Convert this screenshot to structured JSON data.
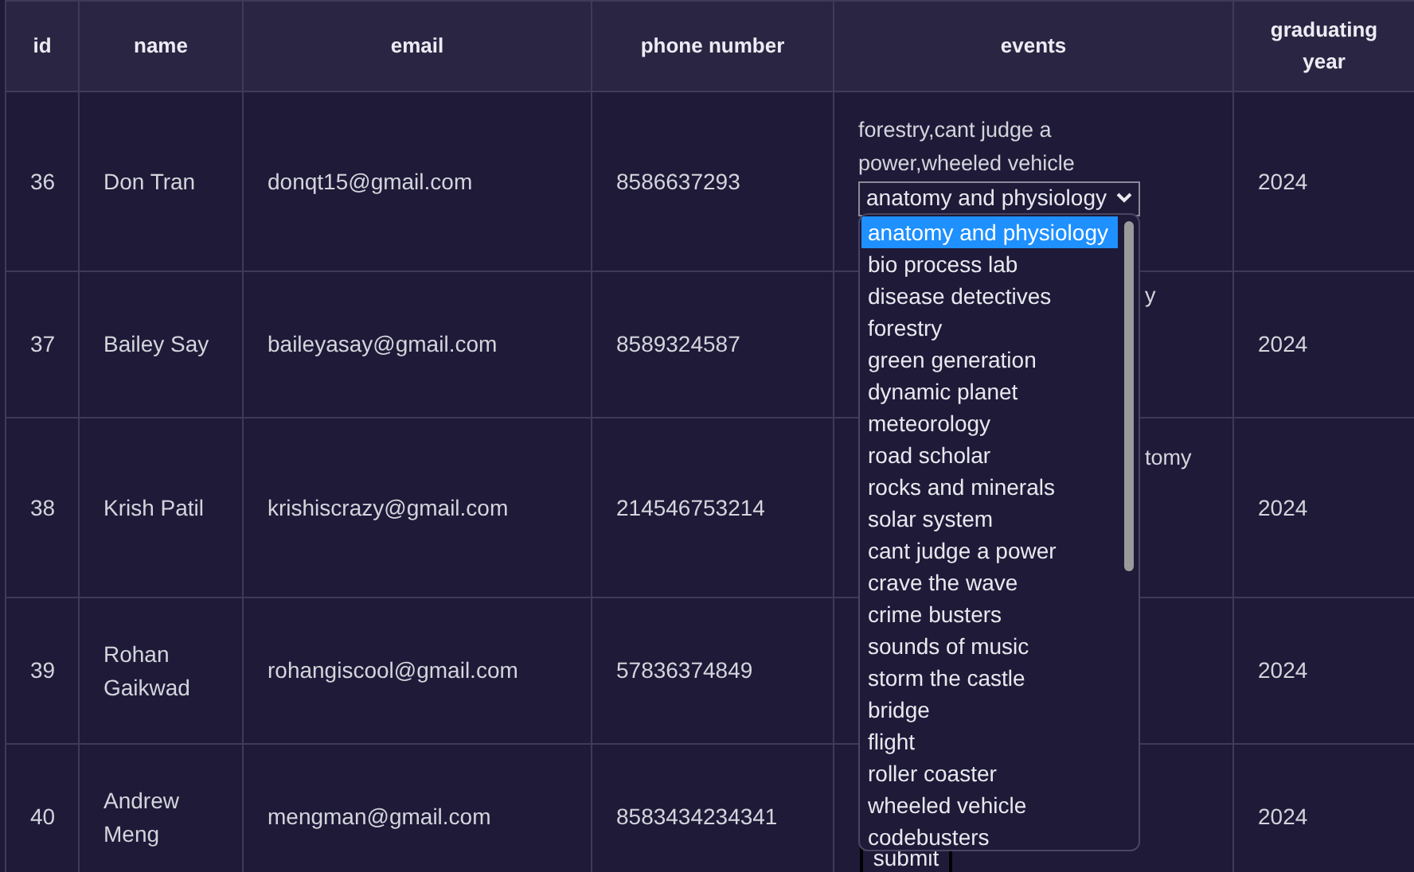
{
  "table": {
    "columns": [
      "id",
      "name",
      "email",
      "phone number",
      "events",
      "graduating year"
    ],
    "rows": [
      {
        "id": "36",
        "name": "Don Tran",
        "email": "donqt15@gmail.com",
        "phone": "8586637293",
        "events": {
          "text": "forestry,cant judge a power,wheeled vehicle",
          "select": "anatomy and physiology"
        },
        "year": "2024"
      },
      {
        "id": "37",
        "name": "Bailey Say",
        "email": "baileyasay@gmail.com",
        "phone": "8589324587",
        "events": {
          "fragment": "y"
        },
        "year": "2024"
      },
      {
        "id": "38",
        "name": "Krish Patil",
        "email": "krishiscrazy@gmail.com",
        "phone": "214546753214",
        "events": {
          "fragment": "tomy"
        },
        "year": "2024"
      },
      {
        "id": "39",
        "name": "Rohan Gaikwad",
        "email": "rohangiscool@gmail.com",
        "phone": "57836374849",
        "events": {},
        "year": "2024"
      },
      {
        "id": "40",
        "name": "Andrew Meng",
        "email": "mengman@gmail.com",
        "phone": "8583434234341",
        "events": {
          "button": "submit"
        },
        "year": "2024"
      }
    ]
  },
  "dropdown": {
    "options": [
      {
        "label": "anatomy and physiology",
        "selected": true
      },
      {
        "label": "bio process lab",
        "selected": false
      },
      {
        "label": "disease detectives",
        "selected": false
      },
      {
        "label": "forestry",
        "selected": false
      },
      {
        "label": "green generation",
        "selected": false
      },
      {
        "label": "dynamic planet",
        "selected": false
      },
      {
        "label": "meteorology",
        "selected": false
      },
      {
        "label": "road scholar",
        "selected": false
      },
      {
        "label": "rocks and minerals",
        "selected": false
      },
      {
        "label": "solar system",
        "selected": false
      },
      {
        "label": "cant judge a power",
        "selected": false
      },
      {
        "label": "crave the wave",
        "selected": false
      },
      {
        "label": "crime busters",
        "selected": false
      },
      {
        "label": "sounds of music",
        "selected": false
      },
      {
        "label": "storm the castle",
        "selected": false
      },
      {
        "label": "bridge",
        "selected": false
      },
      {
        "label": "flight",
        "selected": false
      },
      {
        "label": "roller coaster",
        "selected": false
      },
      {
        "label": "wheeled vehicle",
        "selected": false
      },
      {
        "label": "codebusters",
        "selected": false
      }
    ]
  }
}
